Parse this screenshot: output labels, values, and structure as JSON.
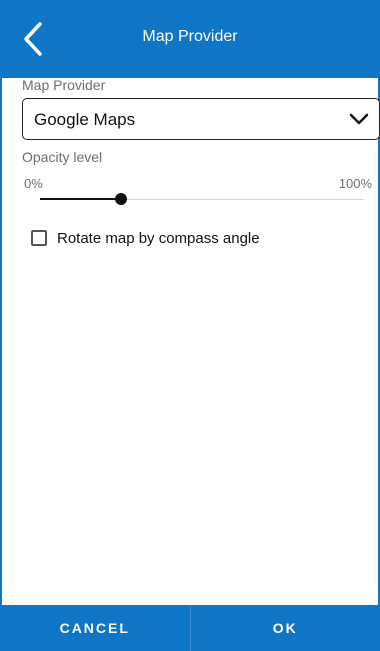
{
  "header": {
    "title": "Map Provider",
    "back_icon": "chevron-left-icon"
  },
  "map_provider": {
    "label": "Map Provider",
    "selected_value": "Google Maps",
    "dropdown_icon": "chevron-down-icon"
  },
  "opacity": {
    "label": "Opacity level",
    "min_label": "0%",
    "max_label": "100%",
    "value_percent": 25
  },
  "rotate_option": {
    "label": "Rotate map by compass angle",
    "checked": false
  },
  "footer": {
    "cancel_label": "CANCEL",
    "ok_label": "OK"
  },
  "colors": {
    "accent": "#0f75c6",
    "text_primary": "#111111",
    "text_secondary": "#6e6e6e"
  }
}
